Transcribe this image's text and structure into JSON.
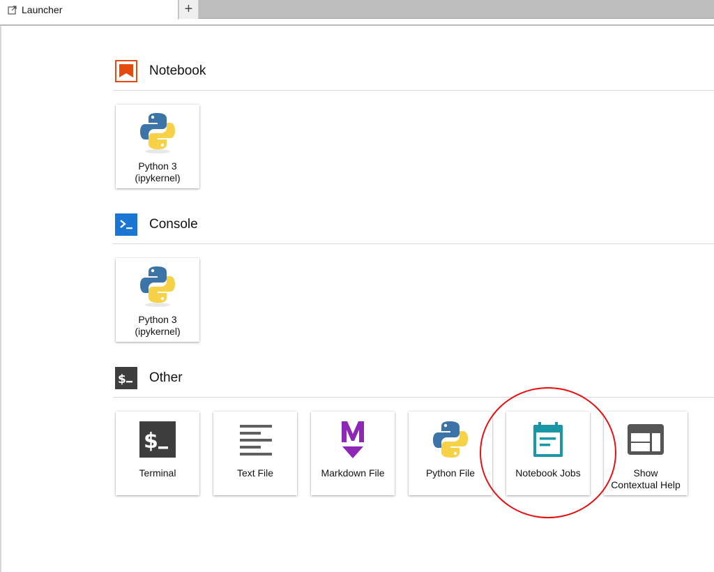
{
  "tabs": {
    "active_label": "Launcher",
    "active_icon": "external-link-icon",
    "add_tab_label": "+"
  },
  "sections": [
    {
      "title": "Notebook",
      "icon": "notebook-bookmark-icon",
      "icon_color": "#e64a0f",
      "items": [
        {
          "label": "Python 3\n(ipykernel)",
          "icon": "python-logo-icon"
        }
      ]
    },
    {
      "title": "Console",
      "icon": "console-prompt-icon",
      "icon_color": "#1976d2",
      "items": [
        {
          "label": "Python 3\n(ipykernel)",
          "icon": "python-logo-icon"
        }
      ]
    },
    {
      "title": "Other",
      "icon": "terminal-icon",
      "icon_color": "#3e3e3e",
      "items": [
        {
          "label": "Terminal",
          "icon": "terminal-icon"
        },
        {
          "label": "Text File",
          "icon": "text-lines-icon"
        },
        {
          "label": "Markdown File",
          "icon": "markdown-icon"
        },
        {
          "label": "Python File",
          "icon": "python-logo-icon"
        },
        {
          "label": "Notebook Jobs",
          "icon": "calendar-icon"
        },
        {
          "label": "Show\nContextual Help",
          "icon": "contextual-help-icon"
        }
      ]
    }
  ],
  "colors": {
    "python_blue": "#3d74a8",
    "python_yellow": "#f7d146",
    "markdown_purple": "#8c28b5",
    "jobs_teal": "#1a96a5",
    "terminal_dark": "#3e3e3e",
    "annotation_red": "#e8100f"
  },
  "annotation": {
    "target": "Notebook Jobs",
    "shape": "circle"
  }
}
